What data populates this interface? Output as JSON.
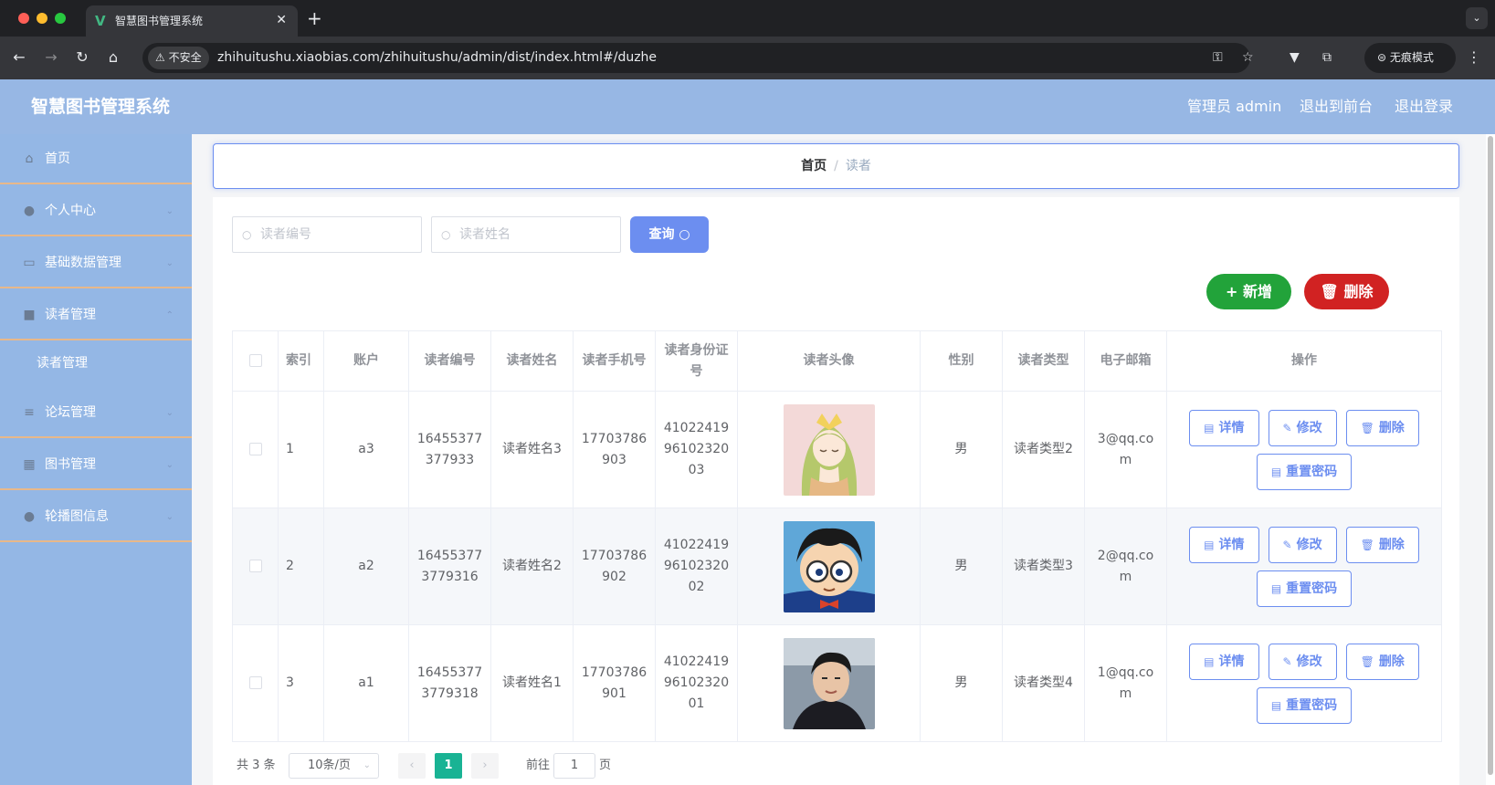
{
  "browser": {
    "tab_title": "智慧图书管理系统",
    "tab_logo": "V",
    "new_tab": "+",
    "tab_close": "✕",
    "secure_label": "不安全",
    "url": "zhihuitushu.xiaobias.com/zhihuitushu/admin/dist/index.html#/duzhe",
    "incognito_label": "无痕模式"
  },
  "header": {
    "title": "智慧图书管理系统",
    "admin_label": "管理员 admin",
    "back_front": "退出到前台",
    "logout": "退出登录",
    "bg_color": "#97b7e4"
  },
  "sidebar": {
    "items": [
      {
        "label": "首页",
        "icon": "home-icon",
        "glyph": "⌂",
        "arrow": ""
      },
      {
        "label": "个人中心",
        "icon": "user-icon",
        "glyph": "●",
        "arrow": "⌄"
      },
      {
        "label": "基础数据管理",
        "icon": "message-icon",
        "glyph": "▭",
        "arrow": "⌄"
      },
      {
        "label": "读者管理",
        "icon": "suitcase-icon",
        "glyph": "■",
        "arrow": "⌃"
      },
      {
        "label": "论坛管理",
        "icon": "list-icon",
        "glyph": "≡",
        "arrow": "⌄"
      },
      {
        "label": "图书管理",
        "icon": "grid-icon",
        "glyph": "▦",
        "arrow": "⌄"
      },
      {
        "label": "轮播图信息",
        "icon": "bulb-icon",
        "glyph": "●",
        "arrow": "⌄"
      }
    ],
    "submenu": {
      "label": "读者管理"
    }
  },
  "breadcrumb": {
    "home": "首页",
    "separator": "/",
    "current": "读者"
  },
  "search": {
    "reader_no_placeholder": "读者编号",
    "reader_name_placeholder": "读者姓名",
    "query_label": "查询"
  },
  "actions": {
    "add_label": "新增",
    "delete_label": "删除"
  },
  "table": {
    "headers": [
      "索引",
      "账户",
      "读者编号",
      "读者姓名",
      "读者手机号",
      "读者身份证号",
      "读者头像",
      "性别",
      "读者类型",
      "电子邮箱",
      "操作"
    ],
    "rows": [
      {
        "index": "1",
        "account": "a3",
        "reader_no": "16455377377933",
        "name": "读者姓名3",
        "phone": "17703786903",
        "id_card": "410224199610232003",
        "avatar": "anime-girl-avatar",
        "gender": "男",
        "type": "读者类型2",
        "email": "3@qq.com"
      },
      {
        "index": "2",
        "account": "a2",
        "reader_no": "164553773779316",
        "name": "读者姓名2",
        "phone": "17703786902",
        "id_card": "410224199610232002",
        "avatar": "cartoon-boy-glasses-avatar",
        "gender": "男",
        "type": "读者类型3",
        "email": "2@qq.com"
      },
      {
        "index": "3",
        "account": "a1",
        "reader_no": "164553773779318",
        "name": "读者姓名1",
        "phone": "17703786901",
        "id_card": "410224199610232001",
        "avatar": "man-portrait-avatar",
        "gender": "男",
        "type": "读者类型4",
        "email": "1@qq.com"
      }
    ],
    "ops": {
      "detail": "详情",
      "edit": "修改",
      "delete": "删除",
      "reset": "重置密码"
    }
  },
  "pagination": {
    "total": "共 3 条",
    "page_size": "10条/页",
    "prev": "‹",
    "next": "›",
    "current": "1",
    "goto_label": "前往",
    "goto_value": "1",
    "page_label": "页"
  },
  "colors": {
    "accent": "#6c8ef0",
    "sidebar": "#94b7e5",
    "add": "#22a33a",
    "danger": "#d12222",
    "pager_active": "#19b394"
  }
}
